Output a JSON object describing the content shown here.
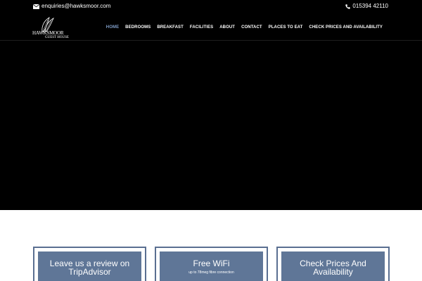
{
  "topbar": {
    "email": "enquiries@hawksmoor.com",
    "email_icon": "envelope-icon",
    "phone": "015394 42110",
    "phone_icon": "phone-icon"
  },
  "logo": {
    "line1": "HAWKSMOOR",
    "line2": "GUEST HOUSE",
    "icon": "feather-icon"
  },
  "nav": {
    "items": [
      {
        "label": "HOME"
      },
      {
        "label": "BEDROOMS"
      },
      {
        "label": "BREAKFAST"
      },
      {
        "label": "FACILITIES"
      },
      {
        "label": "ABOUT"
      },
      {
        "label": "CONTACT"
      },
      {
        "label": "PLACES TO EAT"
      },
      {
        "label": "CHECK PRICES AND AVAILABILITY"
      }
    ],
    "active_index": 0
  },
  "cards": [
    {
      "title": "Leave us a review on TripAdvisor"
    },
    {
      "title": "Free WiFi",
      "subtitle": "up to 78meg fibre connection"
    },
    {
      "title": "Check Prices And Availability"
    }
  ],
  "colors": {
    "hero_bg": "#000000",
    "nav_active": "#7f9dc7",
    "card_fill": "#5f7697",
    "card_border": "#5a6f91"
  }
}
